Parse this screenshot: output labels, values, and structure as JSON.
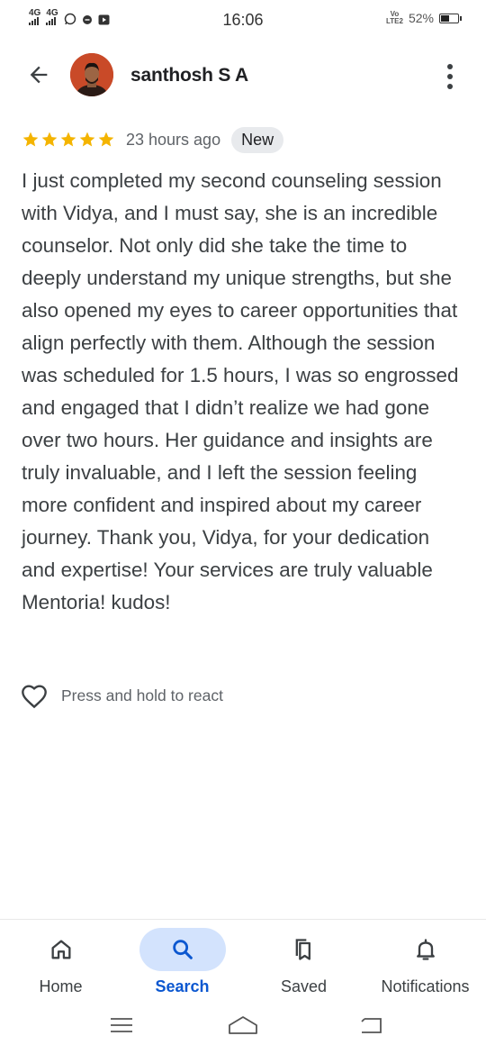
{
  "status_bar": {
    "time": "16:06",
    "network_1": "4G",
    "network_2": "4G",
    "volte_top": "Vo",
    "volte_bottom": "LTE2",
    "battery_percent": "52%",
    "icons": [
      "whatsapp-icon",
      "e-icon",
      "youtube-icon"
    ]
  },
  "header": {
    "author_name": "santhosh S A",
    "back_icon": "arrow-left-icon",
    "more_icon": "more-vert-icon"
  },
  "review": {
    "rating": 5,
    "rating_max": 5,
    "time_ago": "23 hours ago",
    "badge": "New",
    "text": "I just completed my second counseling session with Vidya, and I must say, she is an incredible counselor. Not only did she take the time to deeply understand my unique strengths, but she also opened my eyes to career opportunities that align perfectly with them. Although the session was scheduled for 1.5 hours, I was so engrossed and engaged that I didn’t realize we had gone over two hours. Her guidance and insights are truly invaluable, and I left the session feeling more confident and inspired about my career journey. Thank you, Vidya, for your dedication and expertise! Your services are truly valuable Mentoria! kudos!"
  },
  "react": {
    "label": "Press and hold to react",
    "icon": "heart-outline-icon"
  },
  "bottom_nav": {
    "items": [
      {
        "label": "Home",
        "icon": "home-icon",
        "active": false
      },
      {
        "label": "Search",
        "icon": "search-icon",
        "active": true
      },
      {
        "label": "Saved",
        "icon": "bookmarks-icon",
        "active": false
      },
      {
        "label": "Notifications",
        "icon": "bell-icon",
        "active": false
      }
    ]
  },
  "colors": {
    "star": "#f4b400",
    "active_nav": "#0b57d0",
    "active_pill": "#d3e3fd",
    "badge_bg": "#e8eaed",
    "text": "#3c4043"
  }
}
